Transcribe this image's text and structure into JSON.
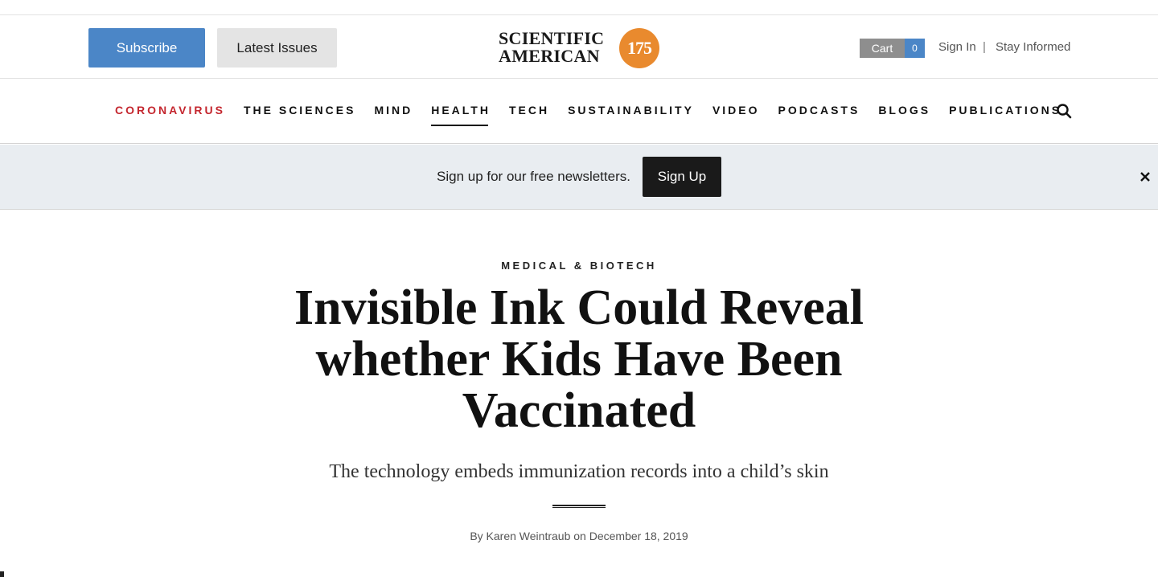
{
  "header": {
    "subscribe_label": "Subscribe",
    "latest_issues_label": "Latest Issues",
    "logo": {
      "line1": "SCIENTIFIC",
      "line2": "AMERICAN",
      "badge": "175"
    },
    "cart_label": "Cart",
    "cart_count": "0",
    "sign_in": "Sign In",
    "separator": "|",
    "stay_informed": "Stay Informed"
  },
  "nav": {
    "items": [
      {
        "label": "CORONAVIRUS"
      },
      {
        "label": "THE SCIENCES"
      },
      {
        "label": "MIND"
      },
      {
        "label": "HEALTH"
      },
      {
        "label": "TECH"
      },
      {
        "label": "SUSTAINABILITY"
      },
      {
        "label": "VIDEO"
      },
      {
        "label": "PODCASTS"
      },
      {
        "label": "BLOGS"
      },
      {
        "label": "PUBLICATIONS"
      }
    ],
    "active": "HEALTH",
    "search_icon": "search-icon"
  },
  "newsletter": {
    "text": "Sign up for our free newsletters.",
    "button_label": "Sign Up",
    "close_icon": "close-icon"
  },
  "article": {
    "category": "MEDICAL & BIOTECH",
    "headline_line1": "Invisible Ink Could Reveal",
    "headline_line2": "whether Kids Have Been",
    "headline_line3": "Vaccinated",
    "subhead": "The technology embeds immunization records into a child’s skin",
    "byline_prefix": "By",
    "author": "Karen Weintraub",
    "byline_on": "on",
    "date": "December 18, 2019"
  },
  "colors": {
    "subscribe_blue": "#4b86c7",
    "coronavirus_red": "#c4262e",
    "badge_orange": "#e98a2e",
    "newsletter_bg": "#e9edf1"
  }
}
